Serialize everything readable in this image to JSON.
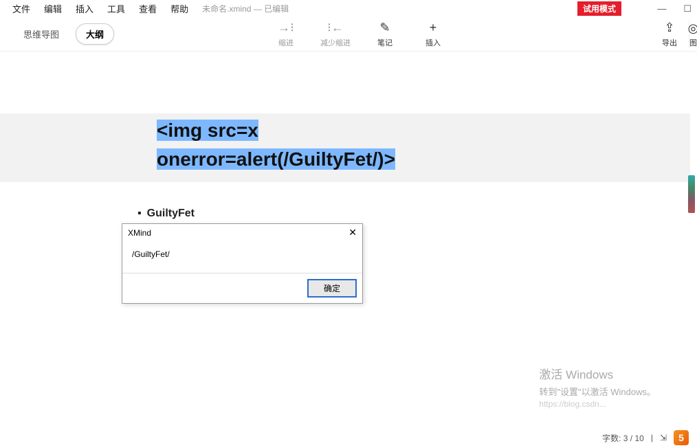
{
  "menubar": {
    "items": [
      "文件",
      "编辑",
      "插入",
      "工具",
      "查看",
      "帮助"
    ],
    "title": "未命名.xmind  — 已编辑"
  },
  "trial_badge": "试用模式",
  "window_controls": {
    "minimize": "—",
    "maximize": "☐"
  },
  "view_tabs": {
    "mindmap": "思维导图",
    "outline": "大纲"
  },
  "toolbar": {
    "indent": {
      "label": "缩进",
      "icon": "→⁝"
    },
    "outdent": {
      "label": "减少缩进",
      "icon": "⁝←"
    },
    "note": {
      "label": "笔记",
      "icon": "✎"
    },
    "insert": {
      "label": "插入",
      "icon": "+"
    },
    "export": {
      "label": "导出",
      "icon": "⇪"
    },
    "image": {
      "label": "图",
      "icon": "◎"
    }
  },
  "content": {
    "selected_line1": "<img src=x",
    "selected_line2": "onerror=alert(/GuiltyFet/)>",
    "outline_item": "GuiltyFet"
  },
  "dialog": {
    "title": "XMind",
    "message": "/GuiltyFet/",
    "ok": "确定"
  },
  "watermark": {
    "title": "激活 Windows",
    "subtitle": "转到\"设置\"以激活 Windows。",
    "url": "https://blog.csdn..."
  },
  "statusbar": {
    "wordcount": "字数: 3 / 10"
  }
}
